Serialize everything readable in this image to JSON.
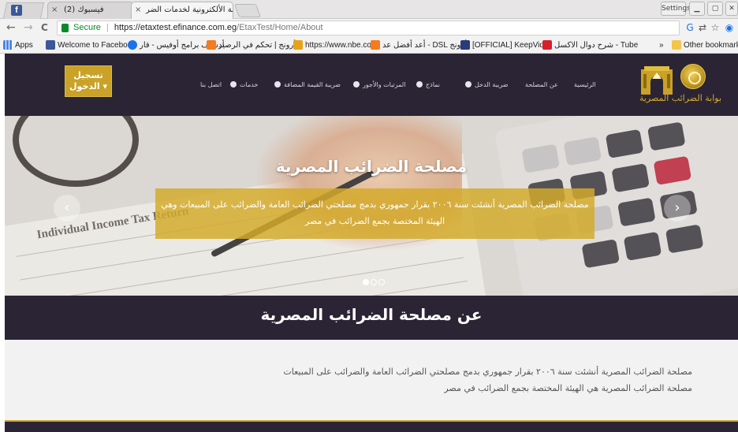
{
  "browser": {
    "tabs": [
      {
        "label": "(2) فيسبوك",
        "active": false
      },
      {
        "label": "البوابة الألكترونية لخدمات الضر",
        "active": true
      }
    ],
    "window_controls": [
      "Settings",
      "Minimize",
      "Restore",
      "Close"
    ],
    "nav": {
      "back": "←",
      "forward": "→",
      "reload": "C"
    },
    "address": {
      "secure_label": "Secure",
      "separator": "|",
      "url_host": "https://etaxtest.efinance.com.eg",
      "url_path": "/EtaxTest/Home/About"
    },
    "bookmarks": [
      "Apps",
      "Welcome to Faceboo",
      "أرشيف برامج أوفيس - قار",
      "أرونج | تحكم في الرصيد",
      "https://www.nbe.com",
      "أعد أفضل عد - DSL أرونج",
      "[OFFICIAL] KeepVid",
      "شرح دوال الاكسل - Tube",
      "»",
      "Other bookmarks"
    ],
    "colors": {
      "facebook": "#3b5998",
      "secure": "#0a8a2a",
      "youtube": "#d8202a",
      "orange": "#f47b20"
    }
  },
  "site": {
    "header": {
      "login_line1": "تسجيل",
      "login_line2": "الدخول ▾",
      "menu": [
        {
          "label": "الرئيسية",
          "has_dot": false
        },
        {
          "label": "عن المصلحة",
          "has_dot": false
        },
        {
          "label": "ضريبة الدخل",
          "has_dot": true
        },
        {
          "label": "نماذج",
          "has_dot": true
        },
        {
          "label": "المرتبات والأجور",
          "has_dot": true
        },
        {
          "label": "ضريبة القيمة المضافة",
          "has_dot": true
        },
        {
          "label": "خدمات",
          "has_dot": true
        },
        {
          "label": "اتصل بنا",
          "has_dot": false
        }
      ],
      "logo_text": "بوابة الضرائب المصرية",
      "colors": {
        "bar": "#2a2434",
        "gold": "#c9a227"
      }
    },
    "hero": {
      "title": "مصلحة الضرائب المصرية",
      "caption_line1": "مصلحة الضرائب المصرية أنشئت سنة ٢٠٠٦ بقرار جمهوري بدمج مصلحتي الضرائب العامة والضرائب على المبيعات وهي",
      "caption_line2": "الهيئة المختصة بجمع الضرائب في مصر",
      "prev_arrow": "‹",
      "next_arrow": "›",
      "slide_count": 3,
      "active_slide": 1
    },
    "about": {
      "heading": "عن مصلحة الضرائب المصرية",
      "paragraph_line1": "مصلحة الضرائب المصرية أنشئت سنة ٢٠٠٦ بقرار جمهوري بدمج مصلحتي الضرائب العامة والضرائب على المبيعات",
      "paragraph_line2": "مصلحة الضرائب المصرية هي الهيئة المختصة بجمع الضرائب في مصر"
    }
  }
}
